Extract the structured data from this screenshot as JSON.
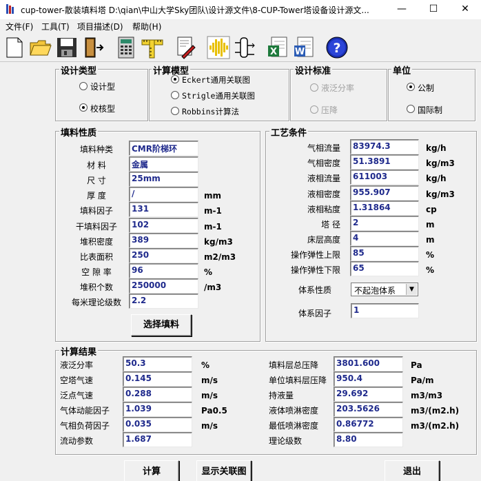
{
  "window": {
    "title": "cup-tower-散装填料塔    D:\\qian\\中山大学Sky团队\\设计源文件\\8-CUP-Tower塔设备设计源文...",
    "minimize_icon": "minimize-icon",
    "maximize_icon": "maximize-icon",
    "close_icon": "close-icon"
  },
  "menu": [
    "文件(F)",
    "工具(T)",
    "项目描述(D)",
    "帮助(H)"
  ],
  "toolbar": [
    "new-file-icon",
    "open-folder-icon",
    "save-disk-icon",
    "exit-door-icon",
    "calculator-icon",
    "ruler-icon",
    "edit-pen-icon",
    "waveform-icon",
    "tower-diagram-icon",
    "excel-export-icon",
    "word-export-icon",
    "help-icon"
  ],
  "design_type": {
    "title": "设计类型",
    "options": [
      "设计型",
      "校核型"
    ],
    "selected": 1
  },
  "calc_model": {
    "title": "计算模型",
    "options": [
      "Eckert通用关联图",
      "Strigle通用关联图",
      "Robbins计算法"
    ],
    "selected": 0
  },
  "design_standard": {
    "title": "设计标准",
    "options": [
      "液泛分率",
      "压降"
    ],
    "selected": 0,
    "disabled": true
  },
  "units": {
    "title": "单位",
    "options": [
      "公制",
      "国际制"
    ],
    "selected": 0
  },
  "packing": {
    "title": "填料性质",
    "rows": [
      {
        "label": "填料种类",
        "value": "CMR阶梯环",
        "unit": ""
      },
      {
        "label": "材    料",
        "value": "金属",
        "unit": ""
      },
      {
        "label": "尺    寸",
        "value": "25mm",
        "unit": ""
      },
      {
        "label": "厚    度",
        "value": "/",
        "unit": "mm"
      },
      {
        "label": "填料因子",
        "value": "131",
        "unit": "m-1"
      },
      {
        "label": "干填料因子",
        "value": "102",
        "unit": "m-1"
      },
      {
        "label": "堆积密度",
        "value": "389",
        "unit": "kg/m3"
      },
      {
        "label": "比表面积",
        "value": "250",
        "unit": "m2/m3"
      },
      {
        "label": "空 隙 率",
        "value": "96",
        "unit": "%"
      },
      {
        "label": "堆积个数",
        "value": "250000",
        "unit": "/m3"
      },
      {
        "label": "每米理论级数",
        "value": "2.2",
        "unit": ""
      }
    ],
    "select_button": "选择填料"
  },
  "process": {
    "title": "工艺条件",
    "rows": [
      {
        "label": "气相流量",
        "value": "83974.3",
        "unit": "kg/h"
      },
      {
        "label": "气相密度",
        "value": "51.3891",
        "unit": "kg/m3"
      },
      {
        "label": "液相流量",
        "value": "611003",
        "unit": "kg/h"
      },
      {
        "label": "液相密度",
        "value": "955.907",
        "unit": "kg/m3"
      },
      {
        "label": "液相粘度",
        "value": "1.31864",
        "unit": "cp"
      },
      {
        "label": "塔    径",
        "value": "2",
        "unit": "m"
      },
      {
        "label": "床层高度",
        "value": "4",
        "unit": "m"
      },
      {
        "label": "操作弹性上限",
        "value": "85",
        "unit": "%"
      },
      {
        "label": "操作弹性下限",
        "value": "65",
        "unit": "%"
      }
    ],
    "system_nature_label": "体系性质",
    "system_nature_value": "不起泡体系",
    "system_factor_label": "体系因子",
    "system_factor_value": "1"
  },
  "results": {
    "title": "计算结果",
    "left": [
      {
        "label": "液泛分率",
        "value": "50.3",
        "unit": "%"
      },
      {
        "label": "空塔气速",
        "value": "0.145",
        "unit": "m/s"
      },
      {
        "label": "泛点气速",
        "value": "0.288",
        "unit": "m/s"
      },
      {
        "label": "气体动能因子",
        "value": "1.039",
        "unit": "Pa0.5"
      },
      {
        "label": "气相负荷因子",
        "value": "0.035",
        "unit": "m/s"
      },
      {
        "label": "流动参数",
        "value": "1.687",
        "unit": ""
      }
    ],
    "right": [
      {
        "label": "填料层总压降",
        "value": "3801.600",
        "unit": "Pa"
      },
      {
        "label": "单位填料层压降",
        "value": "950.4",
        "unit": "Pa/m"
      },
      {
        "label": "持液量",
        "value": "29.692",
        "unit": "m3/m3"
      },
      {
        "label": "液体喷淋密度",
        "value": "203.5626",
        "unit": "m3/(m2.h)"
      },
      {
        "label": "最低喷淋密度",
        "value": "0.86772",
        "unit": "m3/(m2.h)"
      },
      {
        "label": "理论级数",
        "value": "8.80",
        "unit": ""
      }
    ]
  },
  "buttons": {
    "calculate": "计算",
    "show_chart": "显示关联图",
    "exit": "退出"
  }
}
